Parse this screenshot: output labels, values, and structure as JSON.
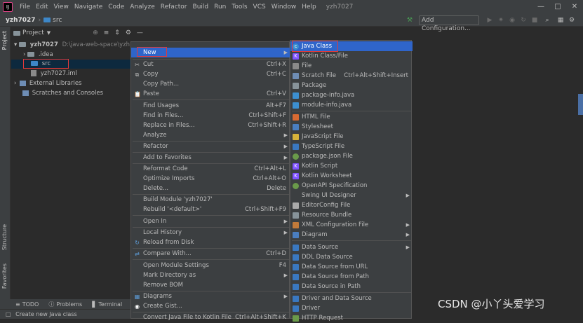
{
  "menubar": {
    "items": [
      "File",
      "Edit",
      "View",
      "Navigate",
      "Code",
      "Analyze",
      "Refactor",
      "Build",
      "Run",
      "Tools",
      "VCS",
      "Window",
      "Help"
    ],
    "window_title": "yzh7027"
  },
  "toolbar": {
    "project": "yzh7027",
    "folder": "src",
    "add_configuration": "Add Configuration..."
  },
  "side_tabs": {
    "project": "Project",
    "structure": "Structure",
    "favorites": "Favorites"
  },
  "project_panel": {
    "title": "Project",
    "root": "yzh7027",
    "root_path": "D:\\java-web-space\\yzh7027",
    "idea": ".idea",
    "src": "src",
    "iml": "yzh7027.iml",
    "external": "External Libraries",
    "scratches": "Scratches and Consoles"
  },
  "context_menu": {
    "new": "New",
    "cut": "Cut",
    "cut_sc": "Ctrl+X",
    "copy": "Copy",
    "copy_sc": "Ctrl+C",
    "copy_path": "Copy Path...",
    "paste": "Paste",
    "paste_sc": "Ctrl+V",
    "find_usages": "Find Usages",
    "find_usages_sc": "Alt+F7",
    "find_in_files": "Find in Files...",
    "find_in_files_sc": "Ctrl+Shift+F",
    "replace_in_files": "Replace in Files...",
    "replace_in_files_sc": "Ctrl+Shift+R",
    "analyze": "Analyze",
    "refactor": "Refactor",
    "add_to_favorites": "Add to Favorites",
    "reformat": "Reformat Code",
    "reformat_sc": "Ctrl+Alt+L",
    "optimize": "Optimize Imports",
    "optimize_sc": "Ctrl+Alt+O",
    "delete": "Delete...",
    "delete_sc": "Delete",
    "build_module": "Build Module 'yzh7027'",
    "rebuild": "Rebuild '<default>'",
    "rebuild_sc": "Ctrl+Shift+F9",
    "open_in": "Open In",
    "local_history": "Local History",
    "reload": "Reload from Disk",
    "compare": "Compare With...",
    "compare_sc": "Ctrl+D",
    "open_module_settings": "Open Module Settings",
    "open_module_settings_sc": "F4",
    "mark_directory": "Mark Directory as",
    "remove_bom": "Remove BOM",
    "diagrams": "Diagrams",
    "create_gist": "Create Gist...",
    "convert": "Convert Java File to Kotlin File",
    "convert_sc": "Ctrl+Alt+Shift+K"
  },
  "submenu": {
    "java_class": "Java Class",
    "kotlin_class": "Kotlin Class/File",
    "file": "File",
    "scratch": "Scratch File",
    "scratch_sc": "Ctrl+Alt+Shift+Insert",
    "package": "Package",
    "package_info": "package-info.java",
    "module_info": "module-info.java",
    "html": "HTML File",
    "stylesheet": "Stylesheet",
    "javascript": "JavaScript File",
    "typescript": "TypeScript File",
    "package_json": "package.json File",
    "kotlin_script": "Kotlin Script",
    "kotlin_worksheet": "Kotlin Worksheet",
    "openapi": "OpenAPI Specification",
    "swing": "Swing UI Designer",
    "editorconfig": "EditorConfig File",
    "resource_bundle": "Resource Bundle",
    "xml_config": "XML Configuration File",
    "diagram": "Diagram",
    "data_source": "Data Source",
    "ddl_data_source": "DDL Data Source",
    "ds_url": "Data Source from URL",
    "ds_path": "Data Source from Path",
    "ds_in_path": "Data Source in Path",
    "driver_ds": "Driver and Data Source",
    "driver": "Driver",
    "http_request": "HTTP Request"
  },
  "bottom": {
    "todo": "TODO",
    "problems": "Problems",
    "terminal": "Terminal",
    "status": "Create new Java class"
  },
  "watermark": "CSDN @小丫头爱学习",
  "colors": {
    "background": "#2b2b2b",
    "panel": "#3c3f41",
    "highlight": "#2f65ca",
    "red_box": "#e03a3a"
  }
}
